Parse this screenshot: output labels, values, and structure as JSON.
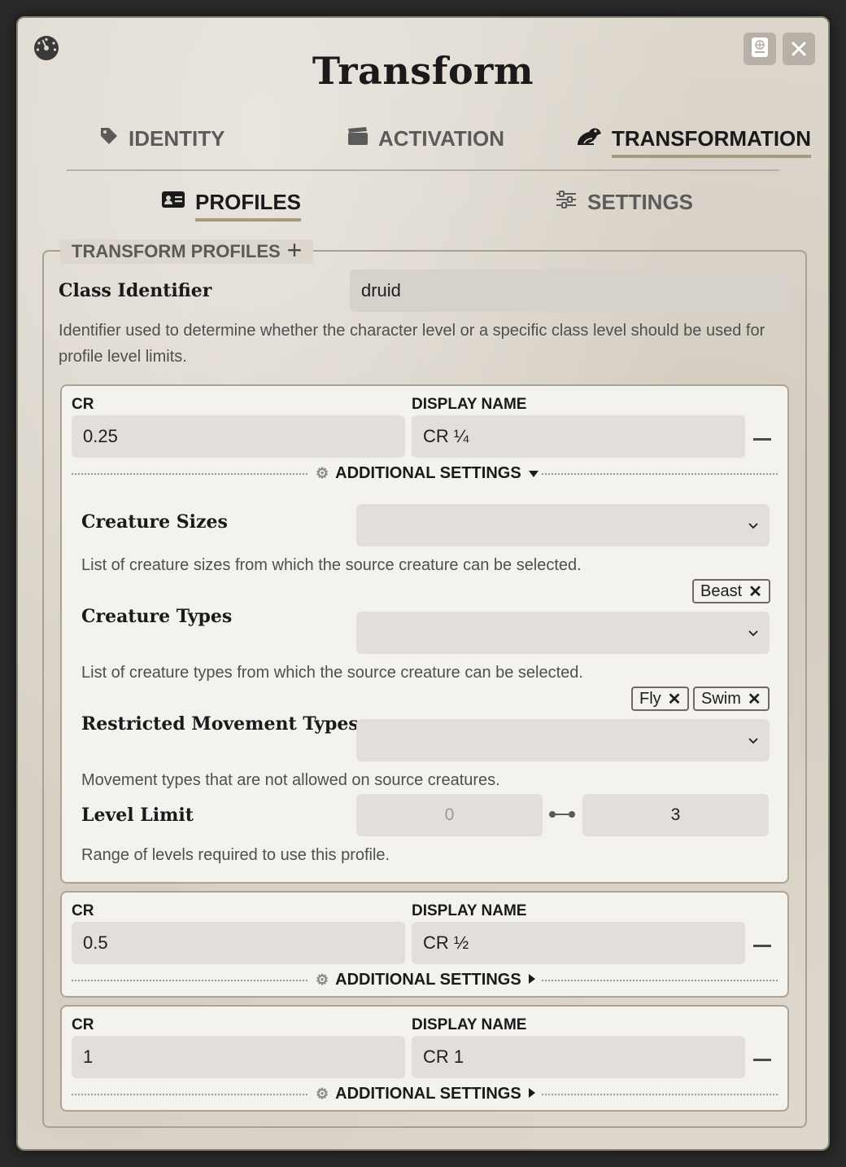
{
  "window": {
    "title": "Transform",
    "icon": "dashboard-gauge-icon",
    "sheet_icon": "sheet-icon",
    "close_icon": "close-icon"
  },
  "tabs": [
    {
      "label": "IDENTITY",
      "icon": "tag-icon",
      "active": false
    },
    {
      "label": "ACTIVATION",
      "icon": "clapperboard-icon",
      "active": false
    },
    {
      "label": "TRANSFORMATION",
      "icon": "frog-icon",
      "active": true
    }
  ],
  "subtabs": [
    {
      "label": "PROFILES",
      "icon": "id-card-icon",
      "active": true
    },
    {
      "label": "SETTINGS",
      "icon": "sliders-icon",
      "active": false
    }
  ],
  "profiles": {
    "legend": "TRANSFORM PROFILES",
    "add_symbol": "+",
    "class_identifier": {
      "label": "Class Identifier",
      "value": "druid",
      "hint": "Identifier used to determine whether the character level or a specific class level should be used for profile level limits."
    },
    "cr_label": "CR",
    "display_name_label": "DISPLAY NAME",
    "additional_settings_label": "ADDITIONAL SETTINGS",
    "items": [
      {
        "cr": "0.25",
        "display_name": "CR ¼",
        "expanded": true,
        "creature_sizes": {
          "label": "Creature Sizes",
          "hint": "List of creature sizes from which the source creature can be selected.",
          "selected": []
        },
        "creature_types": {
          "label": "Creature Types",
          "hint": "List of creature types from which the source creature can be selected.",
          "selected": [
            "Beast"
          ]
        },
        "restricted_movement": {
          "label": "Restricted Movement Types",
          "hint": "Movement types that are not allowed on source creatures.",
          "selected": [
            "Fly",
            "Swim"
          ]
        },
        "level_limit": {
          "label": "Level Limit",
          "min_placeholder": "0",
          "max": "3",
          "hint": "Range of levels required to use this profile."
        }
      },
      {
        "cr": "0.5",
        "display_name": "CR ½",
        "expanded": false
      },
      {
        "cr": "1",
        "display_name": "CR 1",
        "expanded": false
      }
    ]
  },
  "colors": {
    "background": "#ddd7cd",
    "tab_underline": "#a49a80",
    "card": "#f4f2ef",
    "input": "#e2dfda"
  }
}
